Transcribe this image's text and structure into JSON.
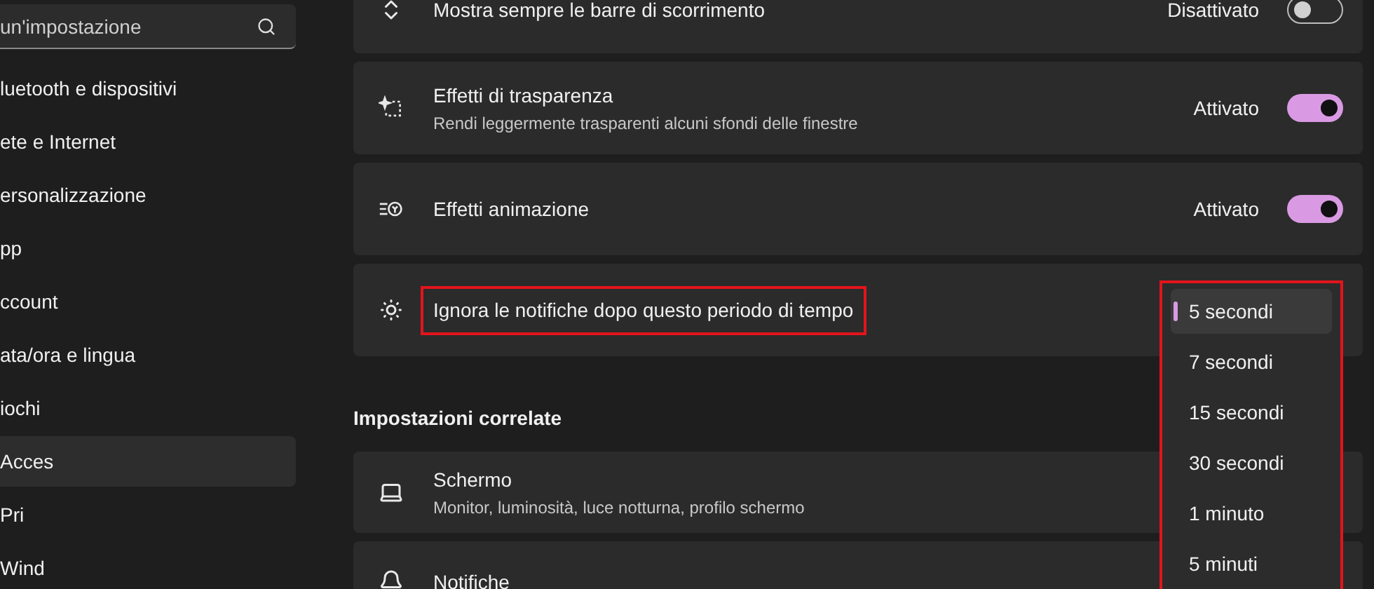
{
  "search": {
    "placeholder": "un'impostazione"
  },
  "sidebar": {
    "items": [
      {
        "label": "luetooth e dispositivi",
        "selected": false
      },
      {
        "label": "ete e Internet",
        "selected": false
      },
      {
        "label": "ersonalizzazione",
        "selected": false
      },
      {
        "label": "pp",
        "selected": false
      },
      {
        "label": "ccount",
        "selected": false
      },
      {
        "label": "ata/ora e lingua",
        "selected": false
      },
      {
        "label": "iochi",
        "selected": false
      },
      {
        "label": "Acces",
        "selected": true
      },
      {
        "label": "Pri",
        "selected": false
      },
      {
        "label": "Wind",
        "selected": false
      }
    ]
  },
  "settings": [
    {
      "kind": "toggle",
      "title": "Mostra sempre le barre di scorrimento",
      "state_label": "Disattivato",
      "on": false
    },
    {
      "kind": "toggle",
      "title": "Effetti di trasparenza",
      "description": "Rendi leggermente trasparenti alcuni sfondi delle finestre",
      "state_label": "Attivato",
      "on": true
    },
    {
      "kind": "toggle",
      "title": "Effetti animazione",
      "state_label": "Attivato",
      "on": true
    },
    {
      "kind": "dropdown",
      "title": "Ignora le notifiche dopo questo periodo di tempo",
      "annotated": true
    }
  ],
  "dropdown": {
    "annotated": true,
    "options": [
      {
        "label": "5 secondi",
        "selected": true
      },
      {
        "label": "7 secondi",
        "selected": false
      },
      {
        "label": "15 secondi",
        "selected": false
      },
      {
        "label": "30 secondi",
        "selected": false
      },
      {
        "label": "1 minuto",
        "selected": false
      },
      {
        "label": "5 minuti",
        "selected": false
      }
    ]
  },
  "related": {
    "heading": "Impostazioni correlate",
    "items": [
      {
        "title": "Schermo",
        "description": "Monitor, luminosità, luce notturna, profilo schermo"
      },
      {
        "title": "Notifiche"
      }
    ]
  }
}
